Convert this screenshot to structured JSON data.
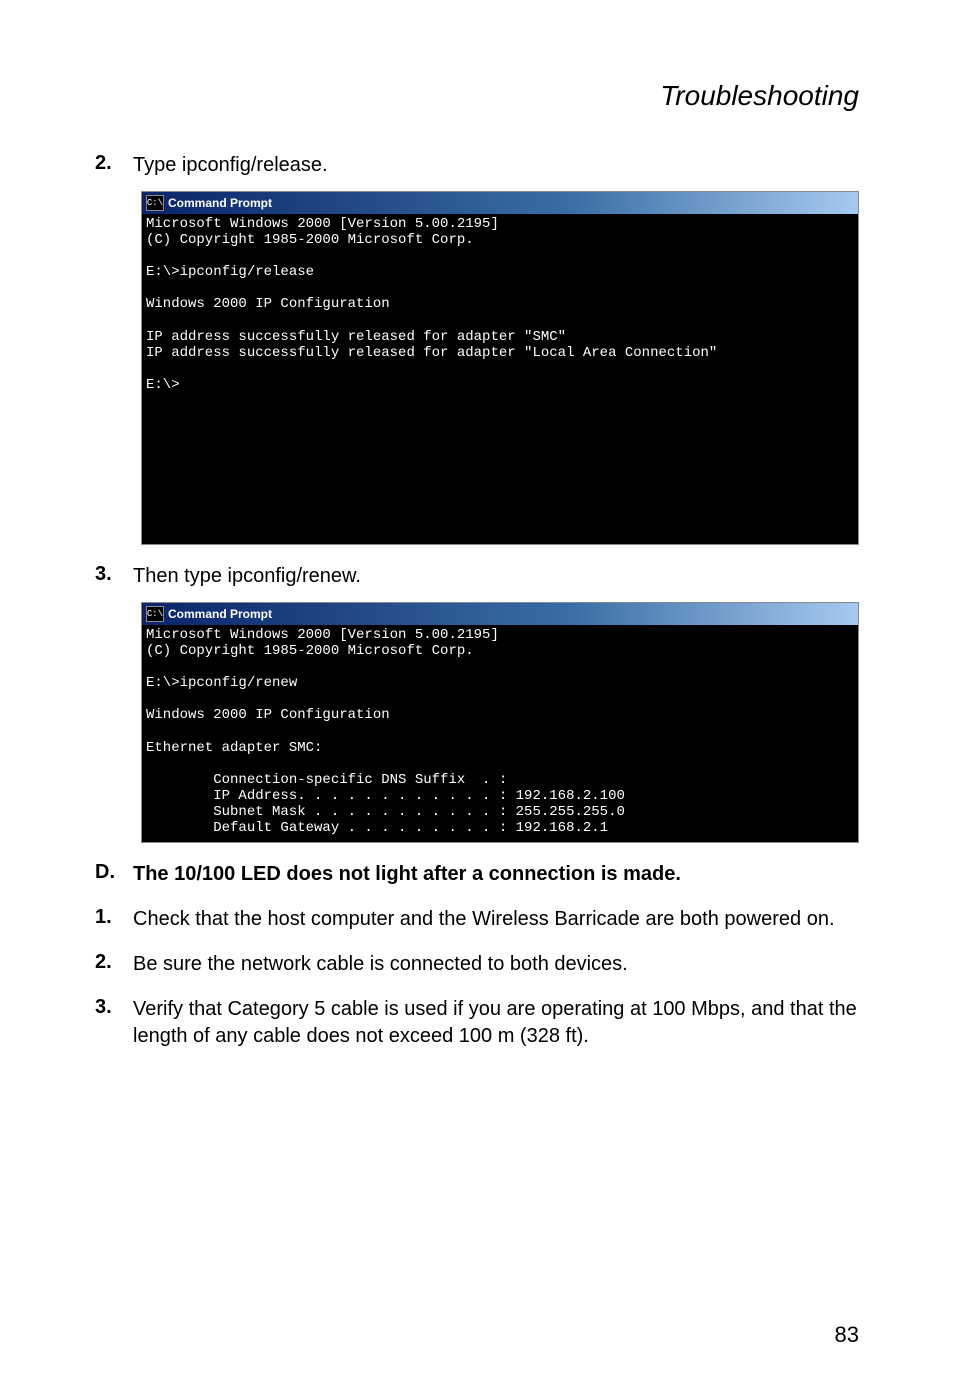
{
  "section_title": "Troubleshooting",
  "step2": {
    "num": "2.",
    "text": "Type ipconfig/release."
  },
  "term1": {
    "icon": "C:\\",
    "title": "Command Prompt",
    "body": "Microsoft Windows 2000 [Version 5.00.2195]\n(C) Copyright 1985-2000 Microsoft Corp.\n\nE:\\>ipconfig/release\n\nWindows 2000 IP Configuration\n\nIP address successfully released for adapter \"SMC\"\nIP address successfully released for adapter \"Local Area Connection\"\n\nE:\\>\n\n\n\n\n\n\n\n\n\n"
  },
  "step3": {
    "num": "3.",
    "text": "Then type ipconfig/renew."
  },
  "term2": {
    "icon": "C:\\",
    "title": "Command Prompt",
    "body": "Microsoft Windows 2000 [Version 5.00.2195]\n(C) Copyright 1985-2000 Microsoft Corp.\n\nE:\\>ipconfig/renew\n\nWindows 2000 IP Configuration\n\nEthernet adapter SMC:\n\n        Connection-specific DNS Suffix  . :\n        IP Address. . . . . . . . . . . . : 192.168.2.100\n        Subnet Mask . . . . . . . . . . . : 255.255.255.0\n        Default Gateway . . . . . . . . . : 192.168.2.1"
  },
  "stepD": {
    "num": "D.",
    "text": "The 10/100 LED does not light after a connection is made."
  },
  "stepD1": {
    "num": "1.",
    "text": "Check that the host computer and the Wireless Barricade are both powered on."
  },
  "stepD2": {
    "num": "2.",
    "text": "Be sure the network cable is connected to both devices."
  },
  "stepD3": {
    "num": "3.",
    "text": "Verify that Category 5 cable is used if you are operating at 100 Mbps, and that the length of any cable does not exceed 100 m (328 ft)."
  },
  "page_number": "83"
}
